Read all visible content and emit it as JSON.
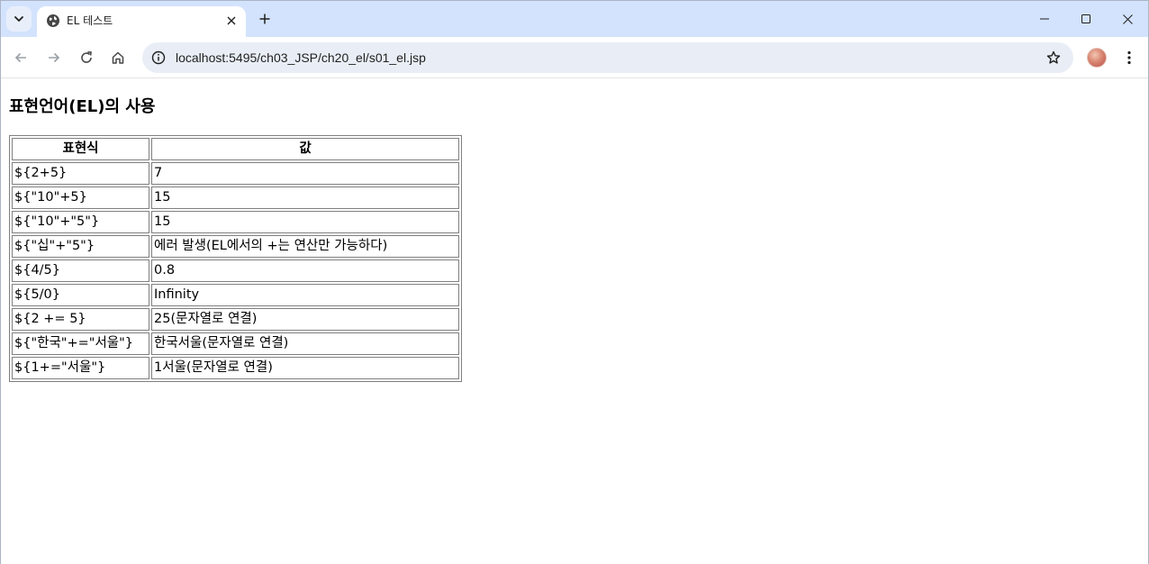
{
  "tab": {
    "title": "EL 테스트"
  },
  "omnibox": {
    "url": "localhost:5495/ch03_JSP/ch20_el/s01_el.jsp"
  },
  "page": {
    "heading": "표현언어(EL)의 사용",
    "table": {
      "headers": [
        "표현식",
        "값"
      ],
      "rows": [
        [
          "${2+5}",
          "7"
        ],
        [
          "${\"10\"+5}",
          "15"
        ],
        [
          "${\"10\"+\"5\"}",
          "15"
        ],
        [
          "${\"십\"+\"5\"}",
          "에러 발생(EL에서의 +는 연산만 가능하다)"
        ],
        [
          "${4/5}",
          "0.8"
        ],
        [
          "${5/0}",
          "Infinity"
        ],
        [
          "${2 += 5}",
          "25(문자열로 연결)"
        ],
        [
          "${\"한국\"+=\"서울\"}",
          "한국서울(문자열로 연결)"
        ],
        [
          "${1+=\"서울\"}",
          "1서울(문자열로 연결)"
        ]
      ]
    }
  },
  "colors": {
    "tabstrip": "#d3e3fd",
    "omnibox": "#e9eef6",
    "icon": "#474747"
  },
  "icons": [
    "tab-search-icon",
    "globe-icon",
    "close-icon",
    "plus-icon",
    "minimize-icon",
    "maximize-icon",
    "back-icon",
    "forward-icon",
    "reload-icon",
    "home-icon",
    "info-icon",
    "star-icon",
    "more-vert-icon"
  ]
}
